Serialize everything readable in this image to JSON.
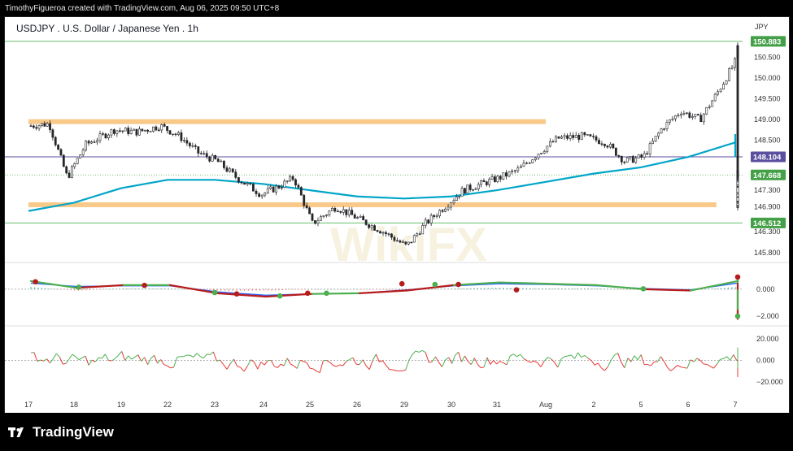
{
  "header": {
    "attribution": "TimothyFigueroa created with TradingView.com, Aug 06, 2025 09:50 UTC+8"
  },
  "footer": {
    "brand": "TradingView"
  },
  "watermark": {
    "text": "WikiFX"
  },
  "colors": {
    "candle": "#26262a",
    "ma": "#00a5c8",
    "support_zone": "#f9c98a",
    "high_line": "#66bb6a",
    "mid_line": "#5b4fa0",
    "low_line": "#66bb6a",
    "macd_green": "#4caf50",
    "macd_red": "#b71c1c",
    "macd_blue": "#2962ff",
    "hist_pos": "#26a69a",
    "hist_neg": "#ef5350",
    "osc_green": "#4caf50",
    "osc_red": "#e53935"
  },
  "chart_data": [
    {
      "type": "candlestick",
      "title": "USDJPY . U.S. Dollar / Japanese Yen . 1h",
      "currency": "JPY",
      "x_ticks": [
        "17",
        "18",
        "19",
        "22",
        "23",
        "24",
        "25",
        "26",
        "29",
        "30",
        "31",
        "Aug",
        "2",
        "5",
        "6",
        "7"
      ],
      "y_ticks": [
        145.8,
        146.3,
        146.9,
        147.3,
        148.5,
        149.0,
        149.5,
        150.0,
        150.5
      ],
      "y_tick_labels": [
        "145.800",
        "146.300",
        "146.900",
        "147.300",
        "148.500",
        "149.000",
        "149.500",
        "150.000",
        "150.500"
      ],
      "ylim": [
        145.6,
        151.35
      ],
      "price_labels": [
        {
          "value": 150.883,
          "label": "150.883",
          "color": "#43a047"
        },
        {
          "value": 148.104,
          "label": "148.104",
          "color": "#5b4fa0"
        },
        {
          "value": 147.668,
          "label": "147.668",
          "color": "#43a047"
        },
        {
          "value": 146.512,
          "label": "146.512",
          "color": "#43a047"
        }
      ],
      "horizontal_levels": [
        150.883,
        148.104,
        146.512
      ],
      "zones": [
        {
          "value": 148.95,
          "from_day": 0,
          "to_day": 11.0
        },
        {
          "value": 146.95,
          "from_day": 0,
          "to_day": 14.6
        }
      ],
      "price_path": [
        [
          0,
          148.85
        ],
        [
          0.4,
          148.9
        ],
        [
          0.8,
          147.6
        ],
        [
          1.2,
          148.4
        ],
        [
          1.8,
          148.75
        ],
        [
          2.3,
          148.7
        ],
        [
          2.8,
          148.85
        ],
        [
          3.2,
          148.6
        ],
        [
          3.6,
          148.2
        ],
        [
          4.0,
          148.0
        ],
        [
          4.4,
          147.6
        ],
        [
          4.9,
          147.2
        ],
        [
          5.3,
          147.4
        ],
        [
          5.6,
          147.6
        ],
        [
          6.0,
          146.5
        ],
        [
          6.5,
          146.9
        ],
        [
          7.0,
          146.6
        ],
        [
          7.5,
          146.3
        ],
        [
          8.0,
          145.95
        ],
        [
          8.4,
          146.5
        ],
        [
          8.8,
          146.9
        ],
        [
          9.2,
          147.3
        ],
        [
          9.6,
          147.45
        ],
        [
          10.0,
          147.6
        ],
        [
          10.4,
          147.8
        ],
        [
          10.8,
          148.2
        ],
        [
          11.2,
          148.55
        ],
        [
          11.7,
          148.6
        ],
        [
          12.2,
          148.45
        ],
        [
          12.6,
          148.0
        ],
        [
          13.0,
          148.1
        ],
        [
          13.4,
          148.8
        ],
        [
          13.8,
          149.2
        ],
        [
          14.2,
          149.0
        ],
        [
          14.6,
          149.7
        ],
        [
          15.0,
          150.5
        ],
        [
          15.4,
          150.8
        ],
        [
          15.7,
          150.7
        ],
        [
          16.0,
          150.3
        ],
        [
          16.1,
          148.6
        ],
        [
          16.5,
          147.5
        ],
        [
          16.9,
          147.1
        ],
        [
          17.3,
          147.7
        ],
        [
          17.7,
          147.6
        ],
        [
          18.0,
          147.3
        ],
        [
          18.4,
          146.95
        ],
        [
          18.8,
          147.0
        ],
        [
          19.2,
          147.25
        ],
        [
          19.6,
          147.7
        ],
        [
          20.0,
          147.6
        ],
        [
          20.4,
          147.65
        ]
      ],
      "moving_average": [
        [
          0,
          146.8
        ],
        [
          1.0,
          147.0
        ],
        [
          2.0,
          147.35
        ],
        [
          3.0,
          147.55
        ],
        [
          4.0,
          147.55
        ],
        [
          5.0,
          147.45
        ],
        [
          6.0,
          147.3
        ],
        [
          7.0,
          147.15
        ],
        [
          8.0,
          147.1
        ],
        [
          9.0,
          147.15
        ],
        [
          10.0,
          147.3
        ],
        [
          11.0,
          147.5
        ],
        [
          12.0,
          147.7
        ],
        [
          13.0,
          147.85
        ],
        [
          14.0,
          148.1
        ],
        [
          15.0,
          148.45
        ],
        [
          16.0,
          148.65
        ],
        [
          17.0,
          148.45
        ],
        [
          18.0,
          148.3
        ],
        [
          19.0,
          148.2
        ],
        [
          20.0,
          148.1
        ],
        [
          20.4,
          148.1
        ]
      ]
    },
    {
      "type": "line",
      "name": "macd",
      "y_ticks": [
        0.0,
        -2.0
      ],
      "y_tick_labels": [
        "0.000",
        "−2.000"
      ],
      "ylim": [
        -2.6,
        1.8
      ],
      "fast_line": [
        [
          0,
          0.6
        ],
        [
          1.0,
          0.1
        ],
        [
          2.0,
          0.3
        ],
        [
          3.0,
          0.3
        ],
        [
          4.0,
          -0.3
        ],
        [
          5.0,
          -0.55
        ],
        [
          6.0,
          -0.35
        ],
        [
          7.0,
          -0.3
        ],
        [
          8.0,
          -0.1
        ],
        [
          9.0,
          0.3
        ],
        [
          10.0,
          0.5
        ],
        [
          11.0,
          0.4
        ],
        [
          12.0,
          0.3
        ],
        [
          13.0,
          0.0
        ],
        [
          14.0,
          -0.1
        ],
        [
          15.0,
          0.6
        ],
        [
          16.0,
          1.0
        ],
        [
          16.5,
          0.4
        ],
        [
          17.0,
          -0.9
        ],
        [
          17.5,
          -2.0
        ],
        [
          18.0,
          -2.2
        ],
        [
          19.0,
          -1.5
        ],
        [
          20.0,
          -0.5
        ],
        [
          20.4,
          -0.1
        ]
      ],
      "slow_line": [
        [
          0,
          0.45
        ],
        [
          1.0,
          0.2
        ],
        [
          2.0,
          0.25
        ],
        [
          3.0,
          0.25
        ],
        [
          4.0,
          -0.2
        ],
        [
          5.0,
          -0.45
        ],
        [
          6.0,
          -0.35
        ],
        [
          7.0,
          -0.3
        ],
        [
          8.0,
          -0.05
        ],
        [
          9.0,
          0.25
        ],
        [
          10.0,
          0.4
        ],
        [
          11.0,
          0.35
        ],
        [
          12.0,
          0.25
        ],
        [
          13.0,
          0.05
        ],
        [
          14.0,
          -0.05
        ],
        [
          15.0,
          0.45
        ],
        [
          16.0,
          0.85
        ],
        [
          16.5,
          0.5
        ],
        [
          17.0,
          -0.5
        ],
        [
          17.5,
          -1.6
        ],
        [
          18.0,
          -2.0
        ],
        [
          19.0,
          -1.6
        ],
        [
          20.0,
          -0.7
        ],
        [
          20.4,
          -0.2
        ]
      ],
      "cross_markers": [
        {
          "x": 0.1,
          "y": 0.55,
          "color": "#b71c1c"
        },
        {
          "x": 1.05,
          "y": 0.15,
          "color": "#4caf50"
        },
        {
          "x": 2.45,
          "y": 0.28,
          "color": "#b71c1c"
        },
        {
          "x": 3.95,
          "y": -0.25,
          "color": "#4caf50"
        },
        {
          "x": 4.4,
          "y": -0.35,
          "color": "#b71c1c"
        },
        {
          "x": 5.3,
          "y": -0.5,
          "color": "#4caf50"
        },
        {
          "x": 5.9,
          "y": -0.3,
          "color": "#b71c1c"
        },
        {
          "x": 6.3,
          "y": -0.3,
          "color": "#4caf50"
        },
        {
          "x": 7.9,
          "y": 0.4,
          "color": "#b71c1c"
        },
        {
          "x": 8.6,
          "y": 0.35,
          "color": "#4caf50"
        },
        {
          "x": 9.1,
          "y": 0.35,
          "color": "#b71c1c"
        },
        {
          "x": 10.35,
          "y": -0.05,
          "color": "#b71c1c"
        },
        {
          "x": 13.0,
          "y": 0.03,
          "color": "#4caf50"
        },
        {
          "x": 16.25,
          "y": 0.9,
          "color": "#b71c1c"
        },
        {
          "x": 18.1,
          "y": -2.0,
          "color": "#4caf50"
        }
      ]
    },
    {
      "type": "line",
      "name": "oscillator",
      "y_ticks": [
        20.0,
        0.0,
        -20.0
      ],
      "y_tick_labels": [
        "20.000",
        "0.000",
        "−20.000"
      ],
      "ylim": [
        -30,
        30
      ]
    }
  ]
}
